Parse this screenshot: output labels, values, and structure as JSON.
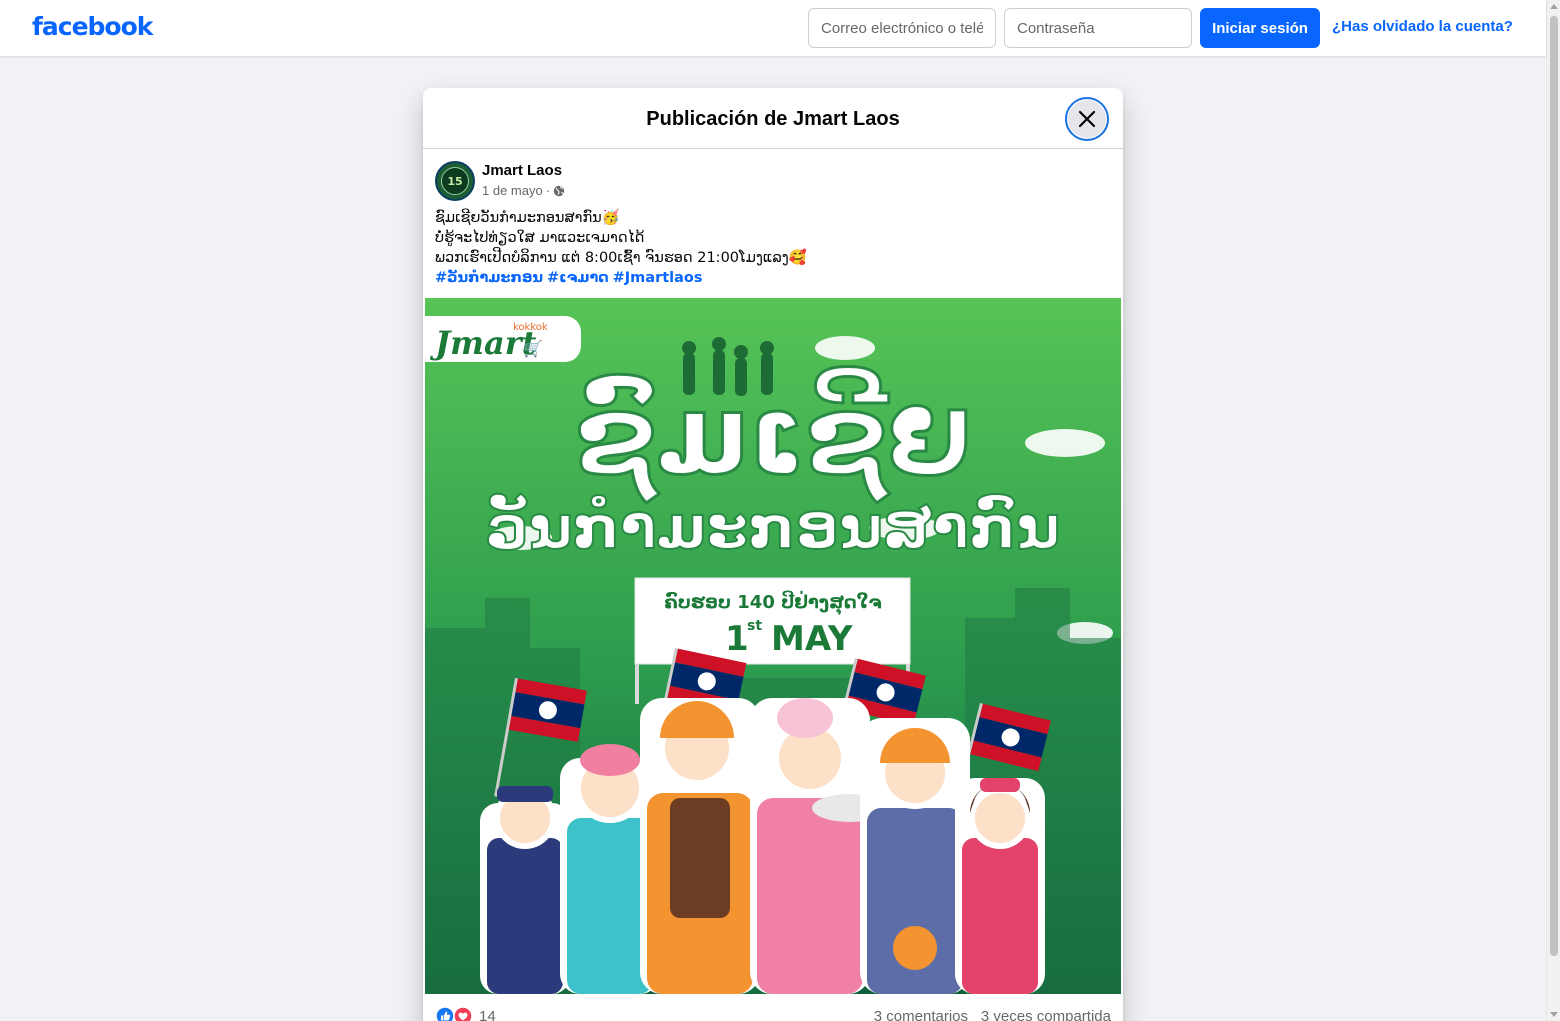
{
  "topbar": {
    "logo": "facebook",
    "email_placeholder": "Correo electrónico o teléfono",
    "password_placeholder": "Contraseña",
    "login_label": "Iniciar sesión",
    "forgot_label": "¿Has olvidado la cuenta?"
  },
  "modal": {
    "title": "Publicación de Jmart Laos",
    "close_icon": "close-icon"
  },
  "post": {
    "author": "Jmart Laos",
    "avatar_badge": "15",
    "date": "1 de mayo",
    "separator": "·",
    "audience_icon": "globe-icon",
    "lines": [
      "ຊົມເຊີຍວັນກຳມະກອນສາກົນ🥳",
      "ບໍ່ຮູ້ຈະໄປທ່ຽວໃສ ມາແວະເຈມາດໄດ້",
      "ພວກເຮົາເປີດບໍລິການ ແຕ່ 8:00ເຊົ້າ ຈົນຮອດ 21:00ໂມງແລງ🥰"
    ],
    "hashtags": [
      "#ວັນກຳມະກອນ",
      "#ເຈມາດ",
      "#Jmartlaos"
    ],
    "image": {
      "brand": "Jmart",
      "brand_sub": "kokkok",
      "headline_1": "ຊົມເຊີຍ",
      "headline_2": "ວັນກຳມະກອນສາກົນ",
      "banner_1": "ຄົບຮອບ 140 ປີຢ່າງສຸດໃຈ",
      "banner_2_num": "1",
      "banner_2_sup": "st",
      "banner_2_word": "MAY"
    },
    "reaction_icons": [
      "like-icon",
      "love-icon"
    ],
    "reaction_count": "14",
    "comments": "3 comentarios",
    "shares": "3 veces compartida"
  },
  "colors": {
    "brand_blue": "#0866ff",
    "image_green": "#2e9e4f",
    "laos_red": "#ce1126",
    "laos_blue": "#002868"
  }
}
